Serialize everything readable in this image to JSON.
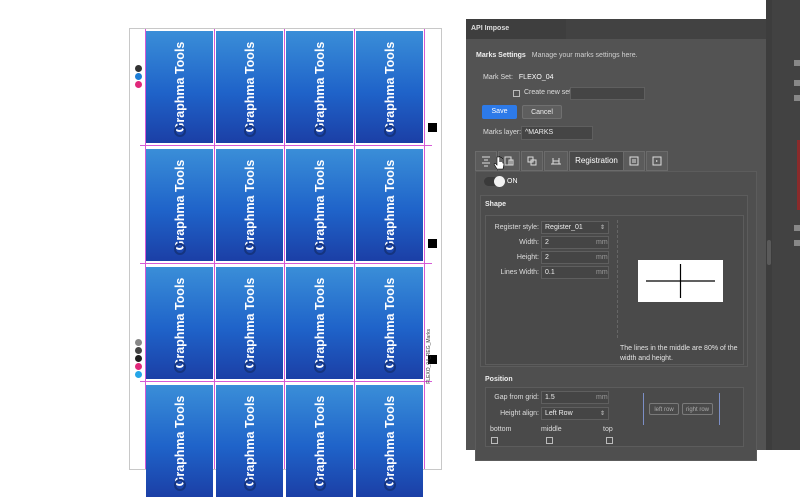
{
  "canvas": {
    "tile_label": "Graphma Tools",
    "slug_text": "FLEXO_04_REG_Marks",
    "colors": {
      "tile_top": "#3a8ed8",
      "tile_bottom": "#1b3fa6",
      "guide": "#d65ad6"
    }
  },
  "panel": {
    "tab_title": "API Impose",
    "header": {
      "title": "Marks Settings",
      "subtitle": "Manage your marks settings here."
    },
    "mark_set": {
      "label": "Mark Set:",
      "value": "FLEXO_04"
    },
    "create_new": {
      "label": "Create new set",
      "value": ""
    },
    "buttons": {
      "save": "Save",
      "cancel": "Cancel"
    },
    "marks_layer": {
      "label": "Marks layer:",
      "value": "^MARKS"
    },
    "tabs": [
      {
        "icon": "align-center-icon"
      },
      {
        "icon": "crop-page-icon"
      },
      {
        "icon": "link-icon"
      },
      {
        "icon": "bars-icon"
      },
      {
        "label": "Registration"
      },
      {
        "icon": "list-icon"
      },
      {
        "icon": "layout-icon"
      }
    ],
    "toggle": {
      "label": "ON",
      "on": true
    },
    "shape": {
      "title": "Shape",
      "register_style": {
        "label": "Register style:",
        "value": "Register_01"
      },
      "width": {
        "label": "Width:",
        "value": "2",
        "unit": "mm"
      },
      "height": {
        "label": "Height:",
        "value": "2",
        "unit": "mm"
      },
      "lines_width": {
        "label": "Lines Width:",
        "value": "0.1",
        "unit": "mm"
      },
      "note": "The lines in the middle are 80% of the width and height."
    },
    "position": {
      "title": "Position",
      "gap_from_grid": {
        "label": "Gap from grid:",
        "value": "1.5",
        "unit": "mm"
      },
      "height_align": {
        "label": "Height align:",
        "value": "Left Row"
      },
      "align_options": [
        "bottom",
        "middle",
        "top"
      ],
      "row_buttons": [
        "left row",
        "right row"
      ]
    },
    "colors": {
      "accent": "#2d7ae8",
      "panel_bg": "#535353"
    }
  }
}
